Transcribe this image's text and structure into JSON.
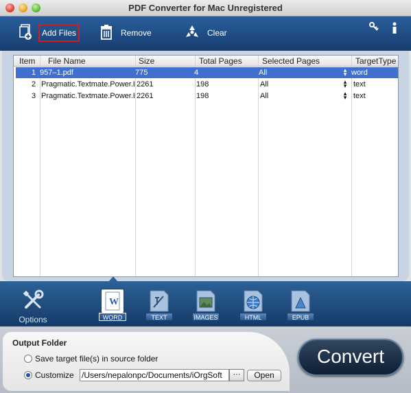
{
  "window": {
    "title": "PDF Converter for Mac Unregistered"
  },
  "toolbar": {
    "add_files": "Add Files",
    "remove": "Remove",
    "clear": "Clear",
    "right_icons": [
      "key-icon",
      "info-icon"
    ]
  },
  "table": {
    "columns": [
      "Item",
      "File Name",
      "Size",
      "Total Pages",
      "Selected Pages",
      "TargetType"
    ],
    "rows": [
      {
        "item": "1",
        "file_name": "957–1.pdf",
        "size": "775",
        "total_pages": "4",
        "selected_pages": "All",
        "target_type": "word",
        "selected": true
      },
      {
        "item": "2",
        "file_name": "Pragmatic.Textmate.Power.E",
        "size": "2261",
        "total_pages": "198",
        "selected_pages": "All",
        "target_type": "text",
        "selected": false
      },
      {
        "item": "3",
        "file_name": "Pragmatic.Textmate.Power.E",
        "size": "2261",
        "total_pages": "198",
        "selected_pages": "All",
        "target_type": "text",
        "selected": false
      }
    ]
  },
  "formats": {
    "options_label": "Options",
    "items": [
      {
        "label": "WORD",
        "icon": "word-doc-icon",
        "active": true
      },
      {
        "label": "TEXT",
        "icon": "text-doc-icon",
        "active": false
      },
      {
        "label": "IMAGES",
        "icon": "images-doc-icon",
        "active": false
      },
      {
        "label": "HTML",
        "icon": "html-doc-icon",
        "active": false
      },
      {
        "label": "EPUB",
        "icon": "epub-doc-icon",
        "active": false
      }
    ]
  },
  "output": {
    "title": "Output Folder",
    "option_source": "Save target file(s) in source folder",
    "option_customize": "Customize",
    "customize_selected": true,
    "path": "/Users/nepalonpc/Documents/iOrgSoft",
    "browse_label": "···",
    "open_label": "Open",
    "convert_label": "Convert"
  },
  "colors": {
    "toolbar": "#1f4d86",
    "selected_row": "#3f70d0",
    "highlight_border": "#d01c1c"
  }
}
